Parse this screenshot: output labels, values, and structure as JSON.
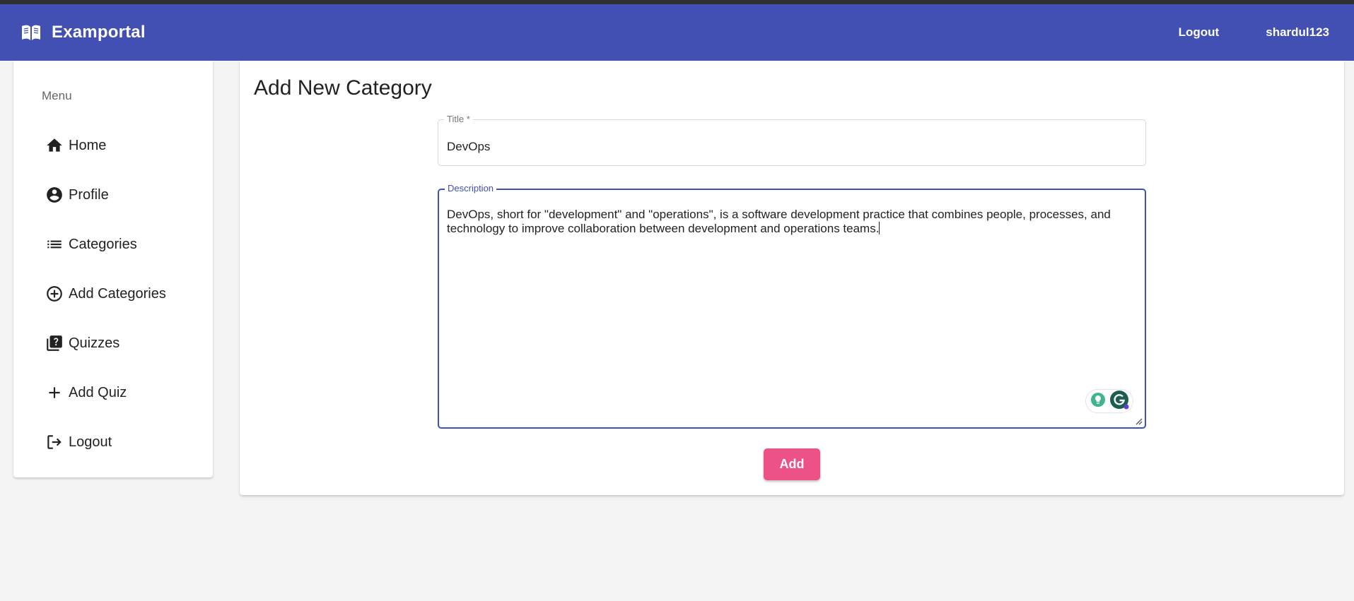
{
  "app": {
    "title": "Examportal"
  },
  "navbar": {
    "logout_label": "Logout",
    "username": "shardul123"
  },
  "sidebar": {
    "header": "Menu",
    "items": [
      {
        "label": "Home",
        "icon": "home-icon"
      },
      {
        "label": "Profile",
        "icon": "account-circle-icon"
      },
      {
        "label": "Categories",
        "icon": "list-icon"
      },
      {
        "label": "Add Categories",
        "icon": "add-circle-icon"
      },
      {
        "label": "Quizzes",
        "icon": "quiz-icon"
      },
      {
        "label": "Add Quiz",
        "icon": "plus-icon"
      },
      {
        "label": "Logout",
        "icon": "logout-icon"
      }
    ]
  },
  "main": {
    "page_title": "Add New Category",
    "title_field": {
      "label": "Title *",
      "value": "DevOps"
    },
    "description_field": {
      "label": "Description",
      "value": "DevOps, short for \"development\" and \"operations\", is a software development practice that combines people, processes, and technology to improve collaboration between development and operations teams."
    },
    "add_button_label": "Add"
  },
  "colors": {
    "primary": "#4350b3",
    "accent": "#ec5288",
    "background": "#f4f4f4"
  }
}
